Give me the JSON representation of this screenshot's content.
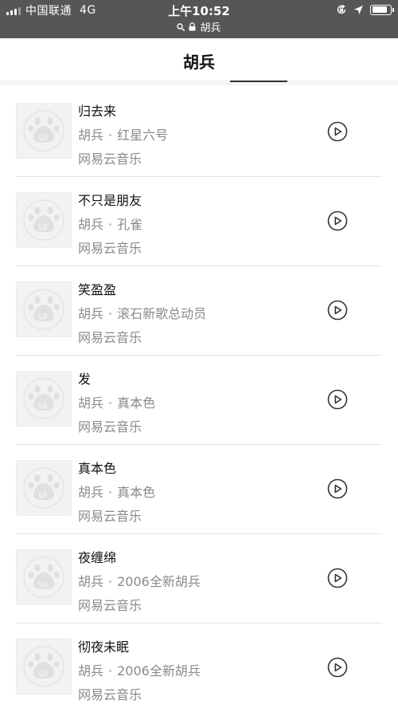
{
  "status_bar": {
    "carrier": "中国联通",
    "network": "4G",
    "time": "上午10:52",
    "url": "胡兵",
    "battery_level": 0.85,
    "icons": [
      "signal-icon",
      "search-icon",
      "lock-icon",
      "orientation-lock-icon",
      "location-icon",
      "battery-icon"
    ]
  },
  "header": {
    "title": "胡兵"
  },
  "songs": [
    {
      "title": "归去来",
      "artist": "胡兵",
      "separator": "·",
      "album": "红星六号",
      "source": "网易云音乐"
    },
    {
      "title": "不只是朋友",
      "artist": "胡兵",
      "separator": "·",
      "album": "孔雀",
      "source": "网易云音乐"
    },
    {
      "title": "笑盈盈",
      "artist": "胡兵",
      "separator": "·",
      "album": "滚石新歌总动员",
      "source": "网易云音乐"
    },
    {
      "title": "发",
      "artist": "胡兵",
      "separator": "·",
      "album": "真本色",
      "source": "网易云音乐"
    },
    {
      "title": "真本色",
      "artist": "胡兵",
      "separator": "·",
      "album": "真本色",
      "source": "网易云音乐"
    },
    {
      "title": "夜缠绵",
      "artist": "胡兵",
      "separator": "·",
      "album": "2006全新胡兵",
      "source": "网易云音乐"
    },
    {
      "title": "彻夜未眠",
      "artist": "胡兵",
      "separator": "·",
      "album": "2006全新胡兵",
      "source": "网易云音乐"
    }
  ],
  "colors": {
    "status_bar_bg": "#565656",
    "text_primary": "#111111",
    "text_secondary": "#8a8a8a",
    "divider": "#e3e3e3",
    "thumb_bg": "#f2f2f2",
    "play_icon": "#333333"
  }
}
